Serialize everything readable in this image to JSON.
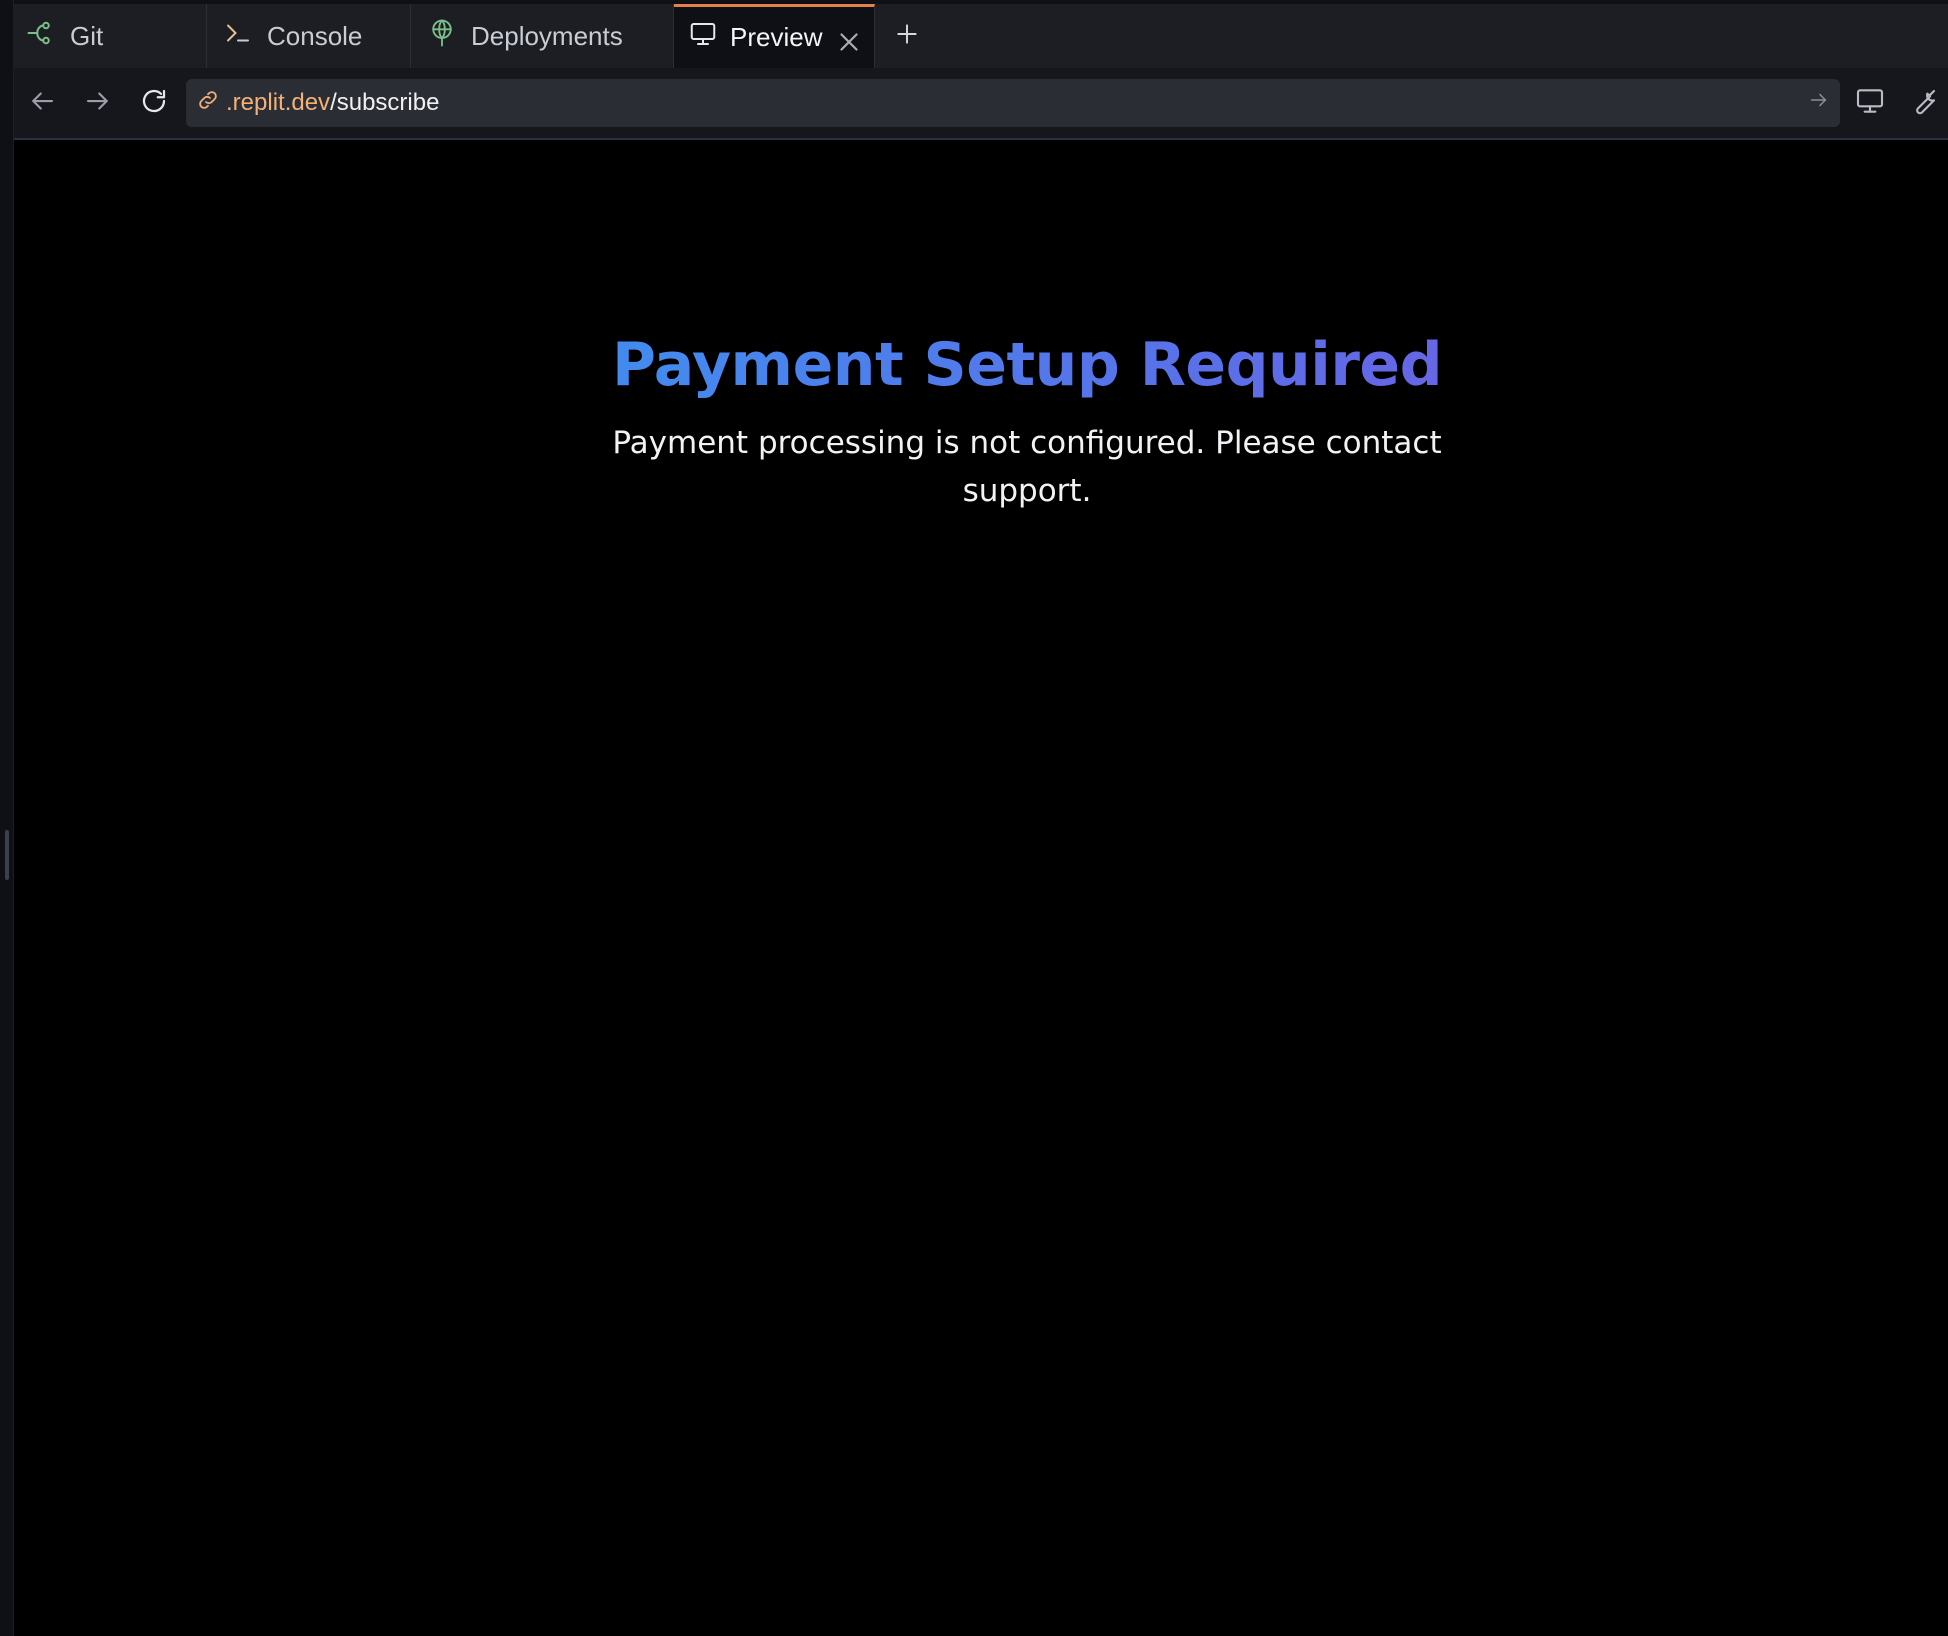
{
  "tabs": [
    {
      "label": "Git",
      "icon": "git-branch-icon"
    },
    {
      "label": "Console",
      "icon": "terminal-icon"
    },
    {
      "label": "Deployments",
      "icon": "deployments-icon"
    },
    {
      "label": "Preview",
      "icon": "monitor-icon",
      "active": true
    }
  ],
  "addressbar": {
    "url_host": ".replit.dev",
    "url_path": "/subscribe"
  },
  "page": {
    "headline": "Payment Setup Required",
    "message": "Payment processing is not configured. Please contact support."
  },
  "colors": {
    "active_tab_accent": "#e4804a",
    "url_host": "#f2b179",
    "headline_gradient_start": "#3f8ff0",
    "headline_gradient_end": "#6b63e3",
    "icon_green": "#7bbf8a"
  }
}
